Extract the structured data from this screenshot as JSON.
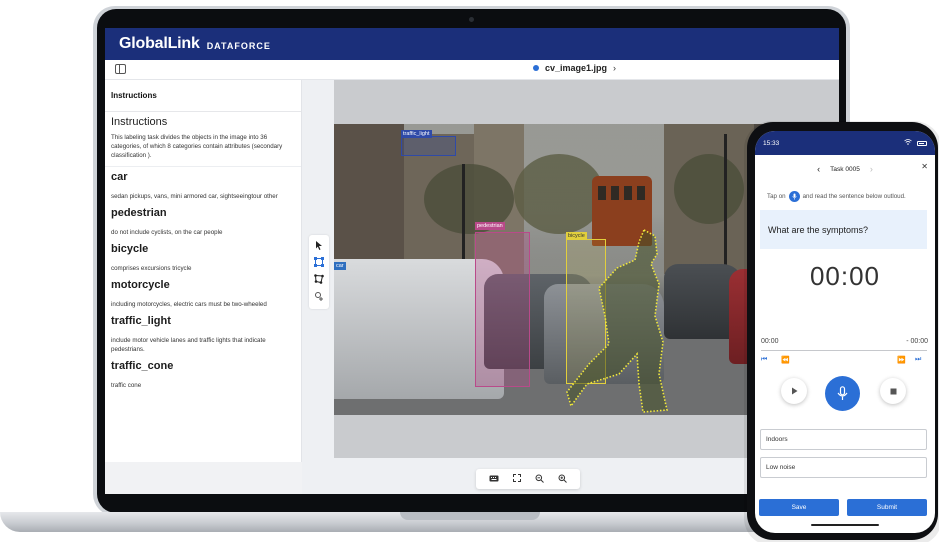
{
  "app": {
    "logo_main": "GlobalLink",
    "logo_sub": "DATAFORCE"
  },
  "file": {
    "name": "cv_image1.jpg"
  },
  "instructions": {
    "header": "Instructions",
    "title": "Instructions",
    "description": "This labeling task divides the objects in the image into 36 categories, of which 8 categories contain attributes (secondary classification ).",
    "categories": [
      {
        "name": "car",
        "desc": "sedan pickups, vans, mini armored car, sightseeingtour other"
      },
      {
        "name": "pedestrian",
        "desc": "do not include cyclists, on the car people"
      },
      {
        "name": "bicycle",
        "desc": "comprises excursions tricycle"
      },
      {
        "name": "motorcycle",
        "desc": "including motorcycles, electric cars must be two-wheeled"
      },
      {
        "name": "traffic_light",
        "desc": "include motor vehicle lanes and traffic lights that indicate pedestrians."
      },
      {
        "name": "traffic_cone",
        "desc": "traffic cone"
      }
    ]
  },
  "canvas": {
    "labels": {
      "traffic_light": "traffic_light",
      "pedestrian": "pedestrian",
      "bicycle": "bicycle",
      "car": "car"
    },
    "tools": [
      "pointer-icon",
      "bounding-box-icon",
      "polygon-icon",
      "point-add-icon"
    ],
    "zoom_bar": [
      "keyboard-icon",
      "fullscreen-icon",
      "zoom-out-icon",
      "zoom-in-icon"
    ]
  },
  "phone": {
    "time": "15:33",
    "task_label": "Task 0005",
    "tip_before": "Tap on",
    "tip_after": "and read the sentence below outloud.",
    "question": "What are the symptoms?",
    "timer": "00:00",
    "elapsed": "00:00",
    "remaining": "- 00:00",
    "fields": [
      "Indoors",
      "Low noise"
    ],
    "save_label": "Save",
    "submit_label": "Submit"
  },
  "colors": {
    "brand_navy": "#1b2f7a",
    "accent_blue": "#2b6fd6",
    "pedestrian_box": "#b94a8a",
    "bicycle_box": "#e2cf3c",
    "traffic_light_box": "#2f4aa8",
    "outline_yellow": "#f2e93a"
  }
}
